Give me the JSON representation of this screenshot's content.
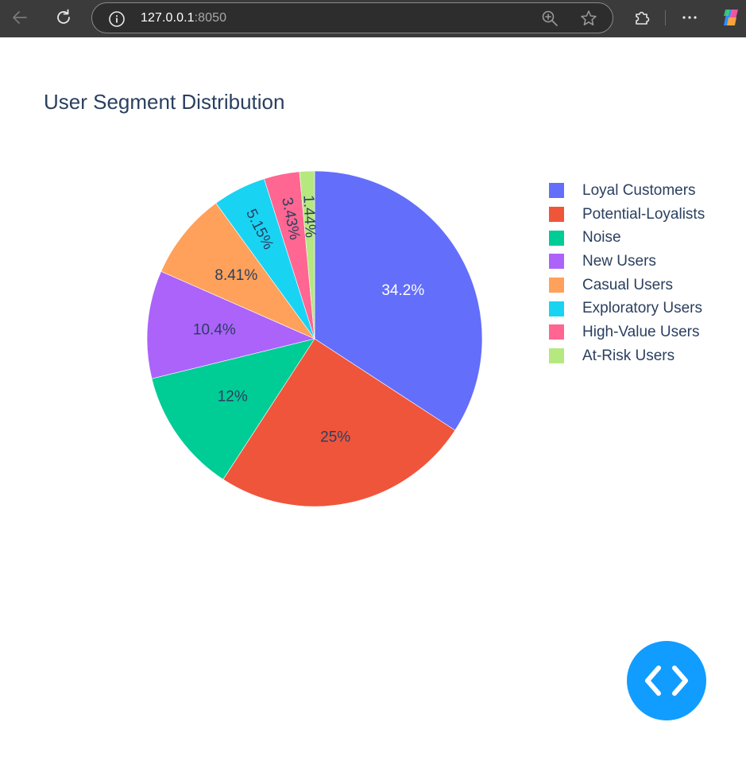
{
  "browser": {
    "url_host": "127.0.0.1",
    "url_port": ":8050"
  },
  "chart_data": {
    "type": "pie",
    "title": "User Segment Distribution",
    "legend_position": "right",
    "categories": [
      "Loyal Customers",
      "Potential-Loyalists",
      "Noise",
      "New Users",
      "Casual Users",
      "Exploratory Users",
      "High-Value Users",
      "At-Risk Users"
    ],
    "values": [
      34.2,
      25,
      12,
      10.4,
      8.41,
      5.15,
      3.43,
      1.44
    ],
    "labels": [
      "34.2%",
      "25%",
      "12%",
      "10.4%",
      "8.41%",
      "5.15%",
      "3.43%",
      "1.44%"
    ],
    "colors": [
      "#636efa",
      "#ef553b",
      "#00cc96",
      "#ab63fa",
      "#ffa15a",
      "#19d3f3",
      "#ff6692",
      "#b6e880"
    ],
    "label_colors": [
      "#ffffff",
      "#2a3f5f",
      "#2a3f5f",
      "#2a3f5f",
      "#2a3f5f",
      "#2a3f5f",
      "#2a3f5f",
      "#2a3f5f"
    ],
    "direction": "clockwise",
    "start_angle": "top"
  },
  "colors": {
    "title": "#2a3f5f",
    "fab": "#119dff",
    "toolbar": "#3b3b3b"
  },
  "icons": {
    "back": "arrow-left-icon",
    "reload": "reload-icon",
    "info": "info-icon",
    "zoom": "zoom-in-icon",
    "favorite": "star-icon",
    "extensions": "puzzle-icon",
    "menu": "more-horizontal-icon",
    "copilot": "copilot-icon",
    "fab": "code-brackets-icon"
  }
}
